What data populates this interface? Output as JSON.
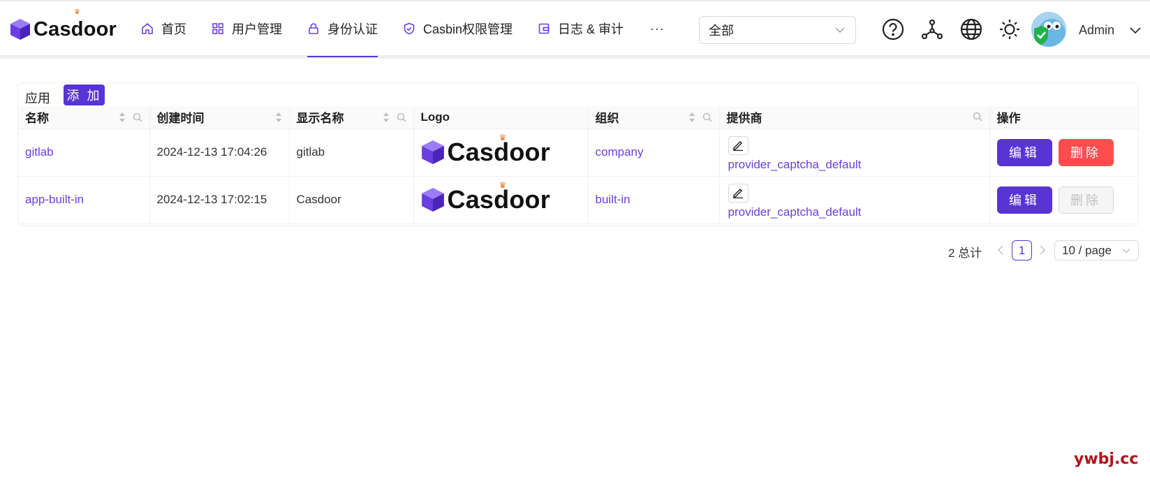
{
  "header": {
    "logo_text": "Casdoor",
    "nav": [
      {
        "label": "首页",
        "icon": "home-icon"
      },
      {
        "label": "用户管理",
        "icon": "grid-icon"
      },
      {
        "label": "身份认证",
        "icon": "lock-icon",
        "active": true
      },
      {
        "label": "Casbin权限管理",
        "icon": "shield-icon"
      },
      {
        "label": "日志 & 审计",
        "icon": "wallet-icon"
      }
    ],
    "more_label": "···",
    "org_select": {
      "value": "全部"
    },
    "user_name": "Admin"
  },
  "card": {
    "title": "应用",
    "add_label": "添 加"
  },
  "table": {
    "columns": [
      "名称",
      "创建时间",
      "显示名称",
      "Logo",
      "组织",
      "提供商",
      "操作"
    ],
    "rows": [
      {
        "name": "gitlab",
        "created": "2024-12-13 17:04:26",
        "display_name": "gitlab",
        "logo_text": "Casdoor",
        "organization": "company",
        "provider": "provider_captcha_default",
        "edit_label": "编辑",
        "delete_label": "删除",
        "delete_disabled": false
      },
      {
        "name": "app-built-in",
        "created": "2024-12-13 17:02:15",
        "display_name": "Casdoor",
        "logo_text": "Casdoor",
        "organization": "built-in",
        "provider": "provider_captcha_default",
        "edit_label": "编辑",
        "delete_label": "删除",
        "delete_disabled": true
      }
    ]
  },
  "pagination": {
    "total_label": "2 总计",
    "current_page": "1",
    "page_size": "10 / page"
  },
  "watermark": "ywbj.cc",
  "colors": {
    "primary": "#5734d3",
    "danger": "#ff4d4f",
    "link": "#6a3ee0"
  }
}
